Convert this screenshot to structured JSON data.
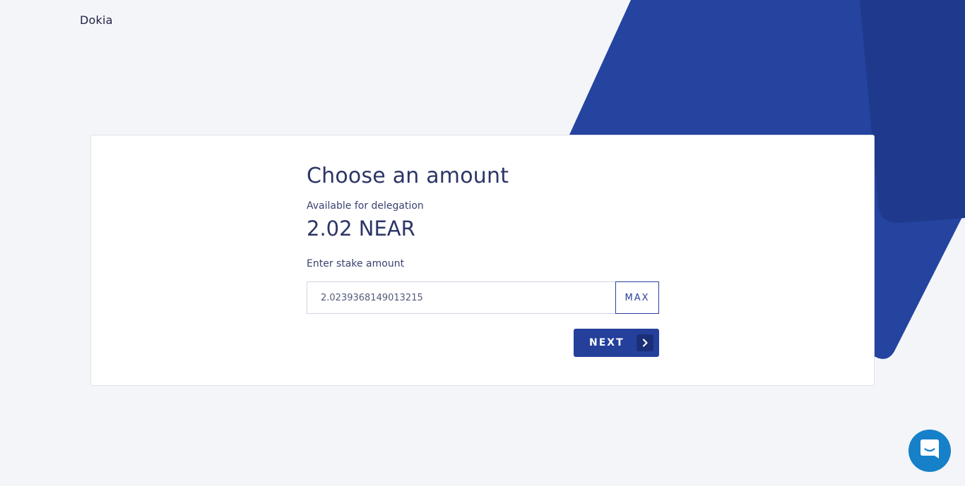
{
  "brand": {
    "name": "Dokia"
  },
  "form": {
    "title": "Choose an amount",
    "available_label": "Available for delegation",
    "available_amount": "2.02 NEAR",
    "stake_label": "Enter stake amount",
    "stake_value": "2.0239368149013215",
    "max_label": "MAX",
    "next_label": "NEXT"
  },
  "icons": {
    "next": "chevron-right-icon",
    "chat": "chat-icon"
  },
  "colors": {
    "accent": "#24409b",
    "background": "#f4f5f9",
    "chat": "#1680c8"
  }
}
